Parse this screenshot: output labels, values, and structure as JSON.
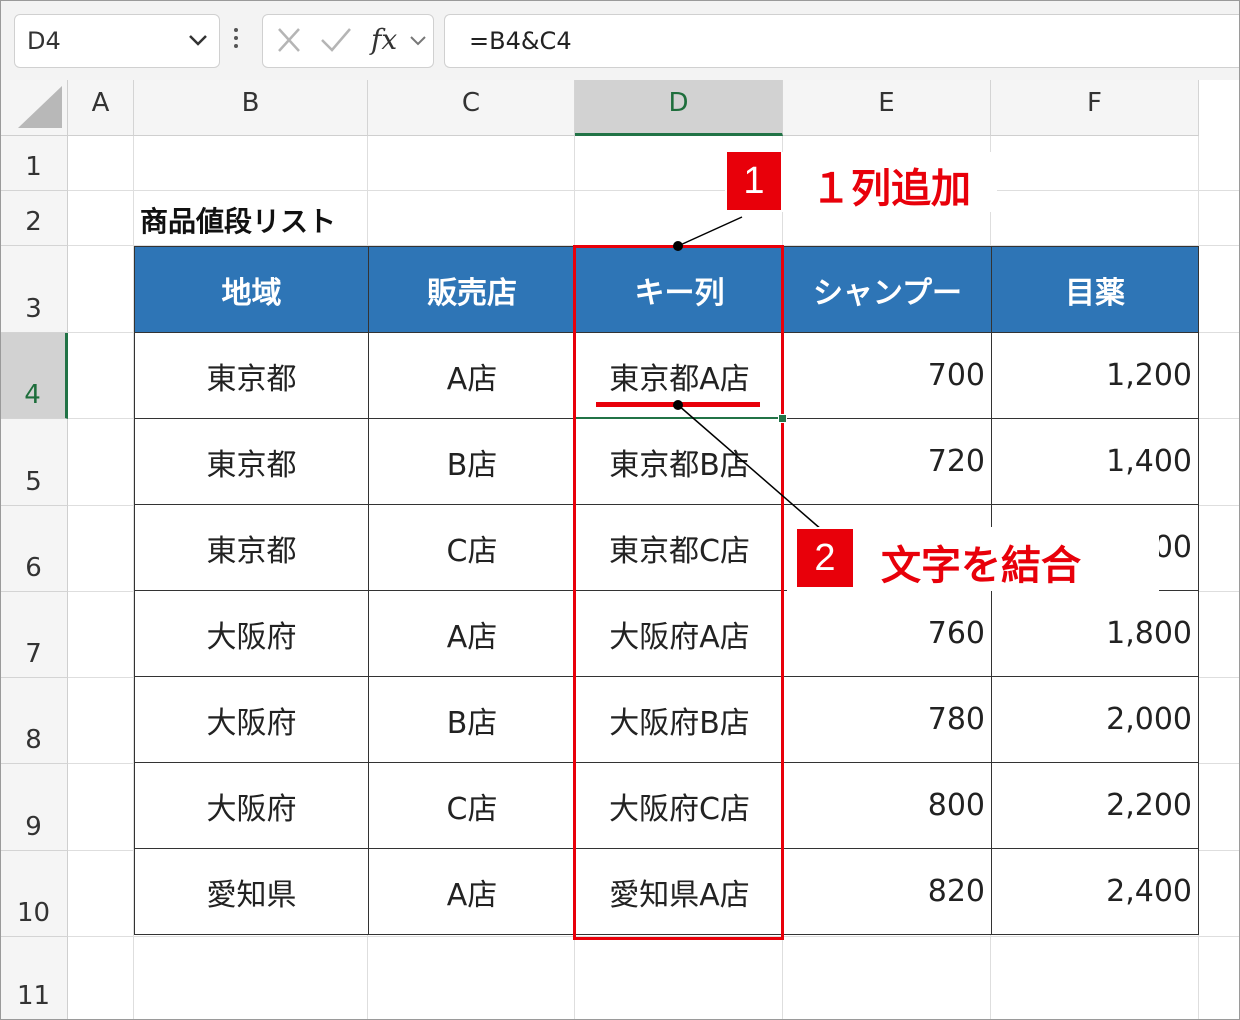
{
  "formula_bar": {
    "name_box": "D4",
    "fx_label": "fx",
    "formula": "=B4&C4"
  },
  "columns": [
    "A",
    "B",
    "C",
    "D",
    "E",
    "F"
  ],
  "selected_column": "D",
  "rows": [
    "1",
    "2",
    "3",
    "4",
    "5",
    "6",
    "7",
    "8",
    "9",
    "10",
    "11"
  ],
  "selected_row": "4",
  "sheet_title": "商品値段リスト",
  "table": {
    "headers": [
      "地域",
      "販売店",
      "キー列",
      "シャンプー",
      "目薬"
    ],
    "rows": [
      [
        "東京都",
        "A店",
        "東京都A店",
        "700",
        "1,200"
      ],
      [
        "東京都",
        "B店",
        "東京都B店",
        "720",
        "1,400"
      ],
      [
        "東京都",
        "C店",
        "東京都C店",
        "",
        "00"
      ],
      [
        "大阪府",
        "A店",
        "大阪府A店",
        "760",
        "1,800"
      ],
      [
        "大阪府",
        "B店",
        "大阪府B店",
        "780",
        "2,000"
      ],
      [
        "大阪府",
        "C店",
        "大阪府C店",
        "800",
        "2,200"
      ],
      [
        "愛知県",
        "A店",
        "愛知県A店",
        "820",
        "2,400"
      ]
    ]
  },
  "annotations": [
    {
      "number": "1",
      "text": "１列追加"
    },
    {
      "number": "2",
      "text": "文字を結合"
    }
  ],
  "colors": {
    "header_blue": "#2e75b6",
    "annotation_red": "#e8000a",
    "excel_green": "#217346"
  }
}
